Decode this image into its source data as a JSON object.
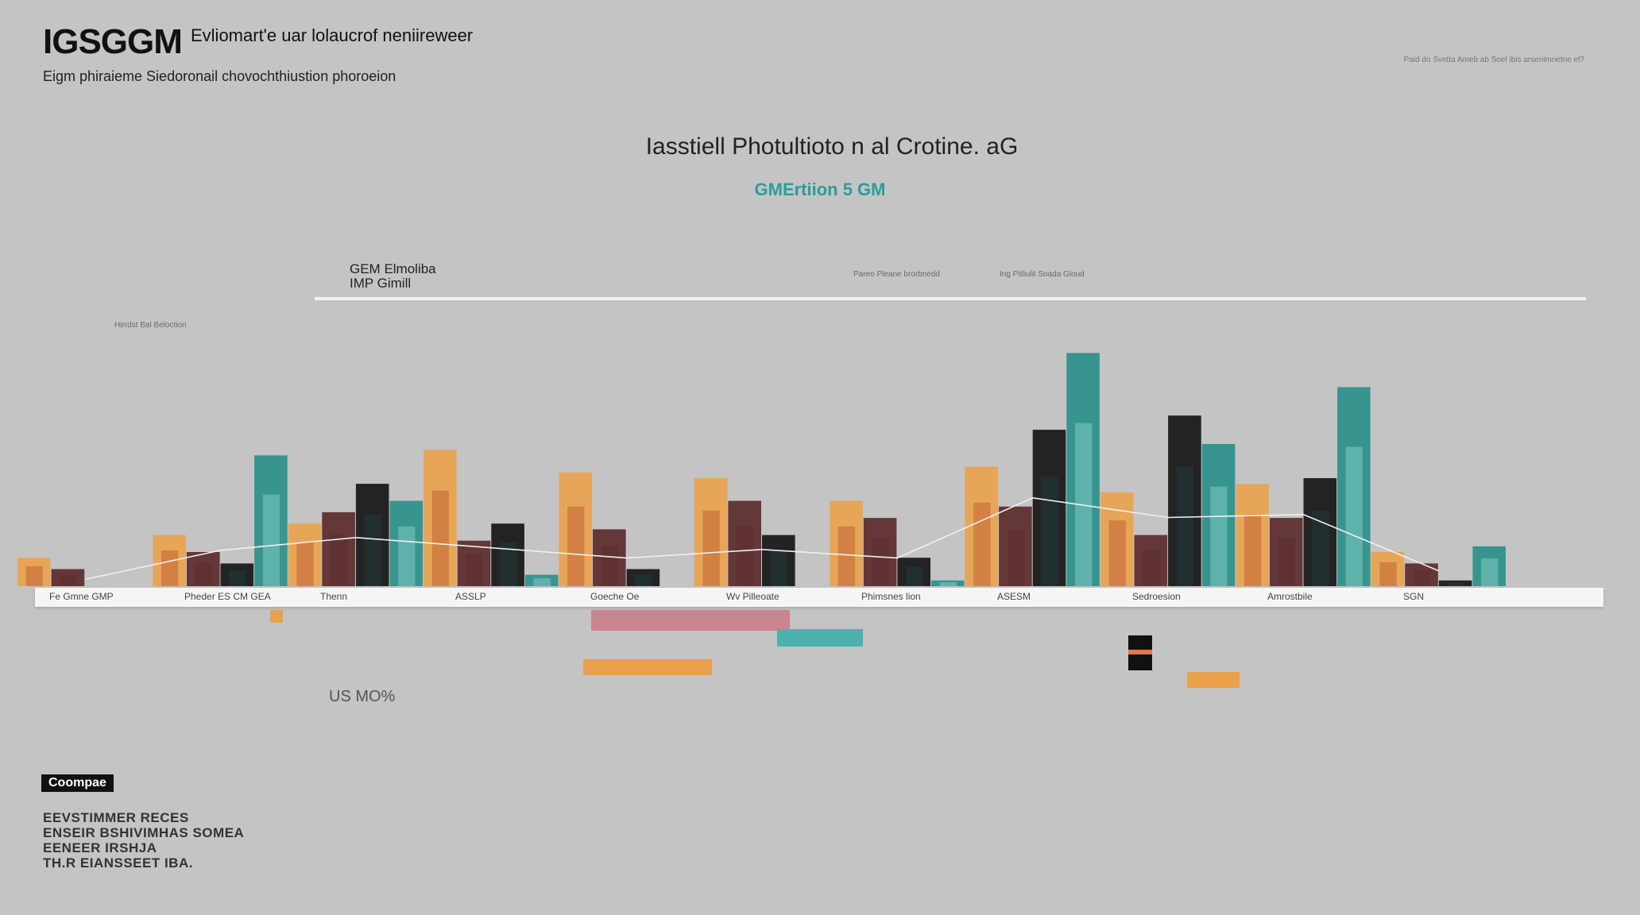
{
  "header": {
    "brand": "IGSGGM",
    "brand_sub": "Evliomart'e uar lolaucrof neniireweer",
    "subtitle": "Eigm phiraieme Siedoronail chovochthiustion phoroeion",
    "top_right_note": "Paid do Svetta  Ameb ab Soel ibis arsenimnetne el?"
  },
  "chart_title": "Iasstiell Photultioto n al Crotine.  aG",
  "series_label": "GMErtiion 5 GM",
  "gem_label": [
    "GEM Elmoliba",
    "IMP Gimill"
  ],
  "annotations": {
    "a1": "Pareo Pleane brorbnedd",
    "a2": "Ing Pitliulit Soada Gloud",
    "a3": "Hirrdst Bal Beloction"
  },
  "us_label": "US MO%",
  "compare_label": "Coompae",
  "tagline": [
    "EEVSTIMMER RECES",
    "ENSEIR BSHIVIMHAS SOMEA",
    "EENEER IRSHJA",
    "TH.R EIANSSEET IBA."
  ],
  "colors": {
    "orange": "#e9a24e",
    "rust": "#b8552a",
    "maroon": "#5b2a2c",
    "black": "#151515",
    "teal": "#2b8f8a",
    "dark_teal": "#1e3f40",
    "mint": "#8fd6cb",
    "pink": "#c9848e"
  },
  "chart_data": {
    "type": "bar",
    "categories": [
      "Fe Gmne GMP",
      "Pheder ES CM GEA",
      "Thenn",
      "ASSLP",
      "Goeche Oe",
      "Wv Pilleoate",
      "Phimsnes lion",
      "ASESM",
      "Sedroesion",
      "Amrostbile",
      "SGN"
    ],
    "ylim": [
      0,
      100
    ],
    "series": [
      {
        "values": [
          10,
          18,
          22,
          48,
          40,
          38,
          30,
          42,
          33,
          36,
          12
        ]
      },
      {
        "values": [
          6,
          12,
          26,
          16,
          20,
          30,
          24,
          28,
          18,
          24,
          8
        ]
      },
      {
        "values": [
          0,
          8,
          36,
          22,
          6,
          18,
          10,
          55,
          60,
          38,
          2
        ]
      },
      {
        "values": [
          0,
          46,
          30,
          4,
          0,
          0,
          2,
          82,
          50,
          70,
          14
        ]
      }
    ]
  }
}
